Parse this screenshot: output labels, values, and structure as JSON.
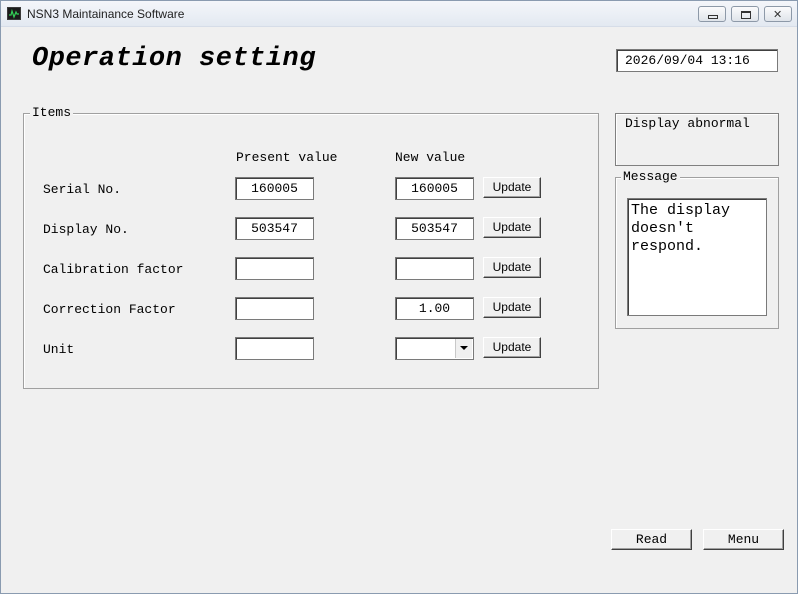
{
  "window": {
    "title": "NSN3 Maintainance Software",
    "icon": "oscilloscope-icon",
    "controls": {
      "minimize": "minimize-icon",
      "maximize": "maximize-icon",
      "close": "close-icon",
      "close_glyph": "✕"
    }
  },
  "header": {
    "title": "Operation setting",
    "datetime": "2026/09/04 13:16"
  },
  "items": {
    "legend": "Items",
    "col_present": "Present value",
    "col_new": "New value",
    "update_label": "Update",
    "rows": [
      {
        "label": "Serial No.",
        "present": "160005",
        "new": "160005"
      },
      {
        "label": "Display No.",
        "present": "503547",
        "new": "503547"
      },
      {
        "label": "Calibration factor",
        "present": "",
        "new": ""
      },
      {
        "label": "Correction Factor",
        "present": "",
        "new": "1.00"
      },
      {
        "label": "Unit",
        "present": "",
        "new": ""
      }
    ]
  },
  "status": {
    "text": "Display abnormal"
  },
  "message": {
    "legend": "Message",
    "text": "The display\ndoesn't\nrespond."
  },
  "footer": {
    "read_label": "Read",
    "menu_label": "Menu"
  }
}
